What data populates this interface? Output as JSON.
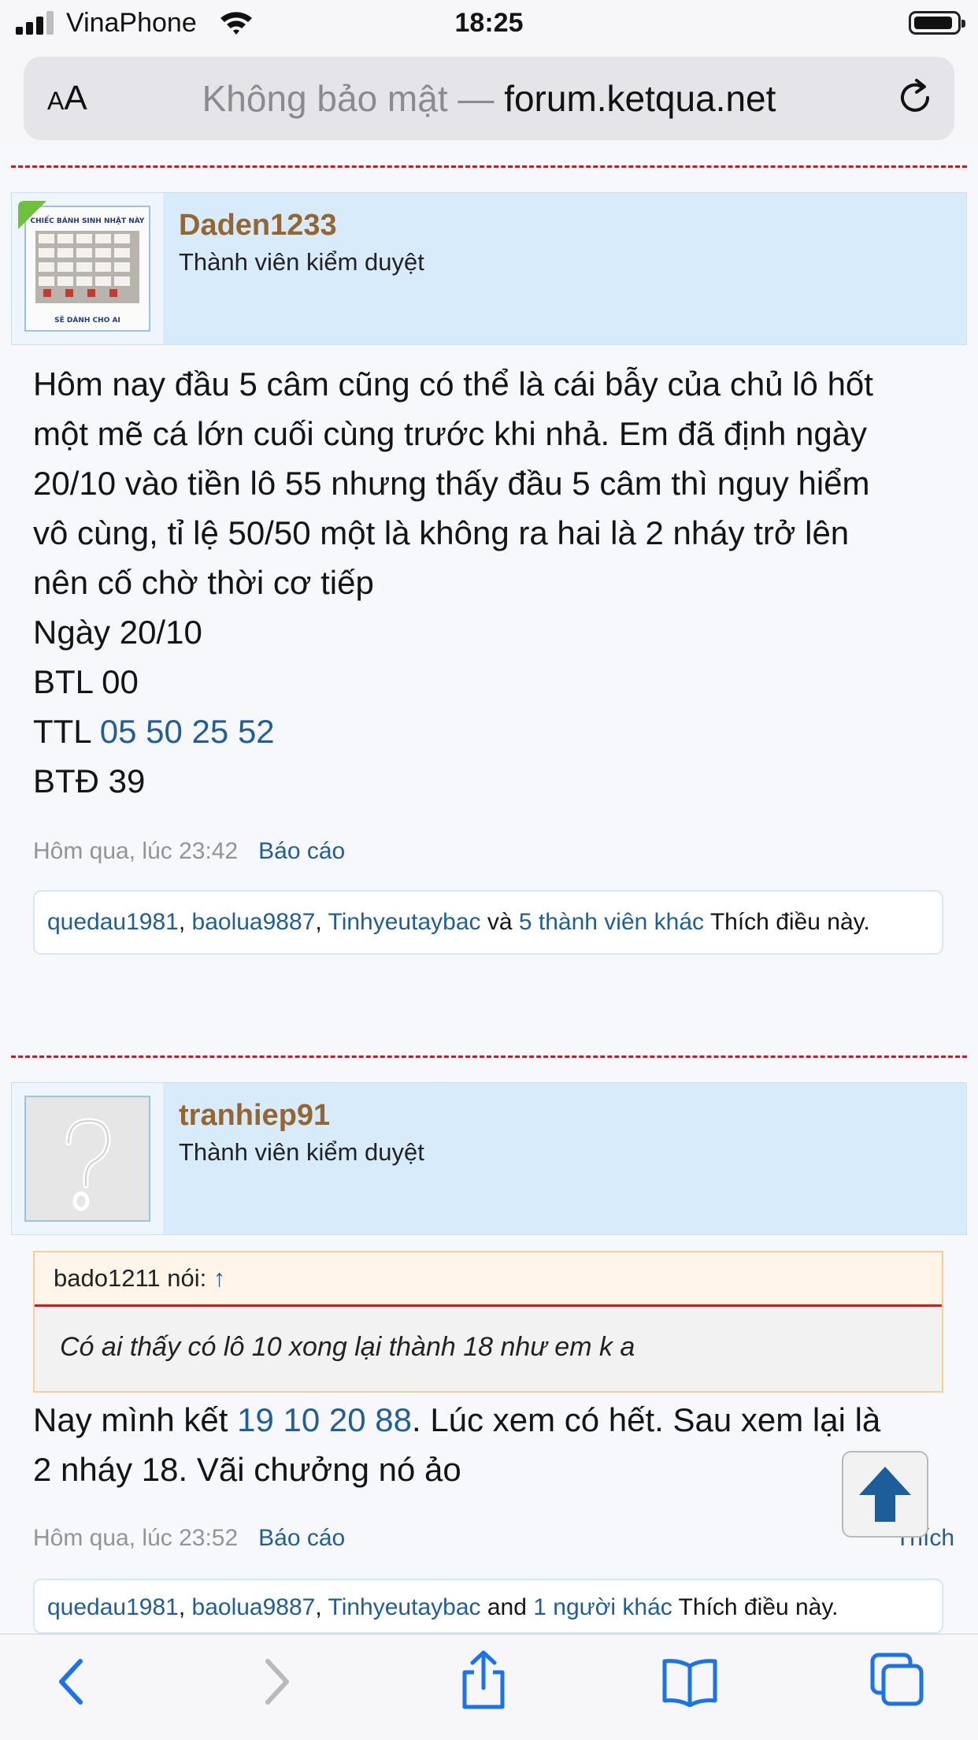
{
  "status_bar": {
    "carrier": "VinaPhone",
    "time": "18:25"
  },
  "address_bar": {
    "aa_small": "A",
    "aa_large": "A",
    "security_text": "Không bảo mật —",
    "domain": "forum.ketqua.net"
  },
  "posts": [
    {
      "username": "Daden1233",
      "role": "Thành viên kiểm duyệt",
      "avatar_caption_top": "CHIẾC BÁNH SINH NHẬT NÀY",
      "avatar_caption_bottom": "SẼ DÀNH CHO AI",
      "lines": [
        "Hôm nay đầu 5 câm cũng có thể là cái bẫy của chủ lô hốt",
        "một mẽ cá lớn cuối cùng trước khi nhả. Em đã định ngày",
        "20/10 vào tiền lô 55 nhưng thấy đầu 5 câm thì nguy hiểm",
        "vô cùng, tỉ lệ 50/50 một là không ra hai là 2 nháy trở lên",
        "nên cố chờ thời cơ tiếp",
        "Ngày 20/10",
        "BTL 00"
      ],
      "ttl_label": "TTL ",
      "ttl_numbers": "05 50 25 52",
      "btd_line": "BTĐ 39",
      "timestamp": "Hôm qua, lúc 23:42",
      "report": "Báo cáo",
      "likes": {
        "user1": "quedau1981",
        "sep1": ", ",
        "user2": "baolua9887",
        "sep2": ", ",
        "user3": "Tinhyeutaybac",
        "connector": " và ",
        "others": "5 thành viên khác",
        "suffix": " Thích điều này."
      }
    },
    {
      "username": "tranhiep91",
      "role": "Thành viên kiểm duyệt",
      "quote": {
        "author": "bado1211 nói: ",
        "arrow": "↑",
        "text": "Có ai thấy có lô 10 xong lại thành 18 như em k a"
      },
      "msg_prefix": "Nay mình kết ",
      "msg_numbers": "19 10 20 88",
      "msg_rest_1": ". Lúc xem có hết. Sau xem lại là",
      "msg_line2": "2 nháy 18. Vãi chưởng nó ảo",
      "timestamp": "Hôm qua, lúc 23:52",
      "report": "Báo cáo",
      "like_action": "Thích",
      "likes": {
        "user1": "quedau1981",
        "sep1": ", ",
        "user2": "baolua9887",
        "sep2": ", ",
        "user3": "Tinhyeutaybac",
        "connector": " and ",
        "others": "1 người khác",
        "suffix": " Thích điều này."
      }
    }
  ],
  "icons": [
    "signal-icon",
    "wifi-icon",
    "battery-icon",
    "reload-icon",
    "scroll-top-icon",
    "back-icon",
    "forward-icon",
    "share-icon",
    "bookmarks-icon",
    "tabs-icon"
  ],
  "colors": {
    "link": "#1f5e96",
    "username": "#946631",
    "author_bar": "#d8ebfb",
    "divider": "#d8151b",
    "toolbar_icon": "#1a73e8"
  }
}
